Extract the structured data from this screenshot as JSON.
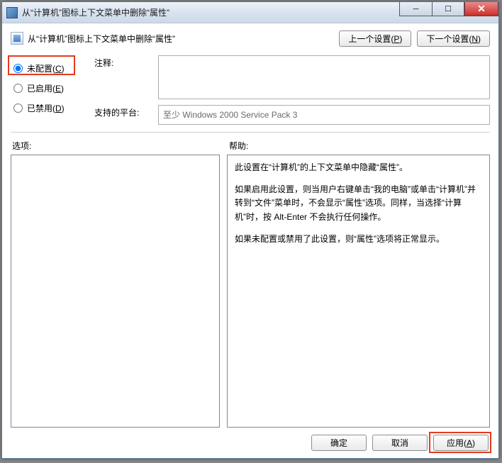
{
  "title": "从“计算机”图标上下文菜单中删除“属性”",
  "header_text": "从“计算机”图标上下文菜单中删除“属性”",
  "nav": {
    "prev": "上一个设置(P)",
    "next": "下一个设置(N)"
  },
  "radios": {
    "not_configured": "未配置(C)",
    "enabled": "已启用(E)",
    "disabled": "已禁用(D)"
  },
  "labels": {
    "comment": "注释:",
    "platform": "支持的平台:",
    "options": "选项:",
    "help": "帮助:"
  },
  "platform_text": "至少 Windows 2000 Service Pack 3",
  "help_paragraphs": [
    "此设置在“计算机”的上下文菜单中隐藏“属性”。",
    "如果启用此设置，则当用户右键单击“我的电脑”或单击“计算机”并转到“文件”菜单时，不会显示“属性”选项。同样，当选择“计算机”时，按 Alt-Enter 不会执行任何操作。",
    "如果未配置或禁用了此设置，则“属性”选项将正常显示。"
  ],
  "buttons": {
    "ok": "确定",
    "cancel": "取消",
    "apply": "应用(A)"
  }
}
